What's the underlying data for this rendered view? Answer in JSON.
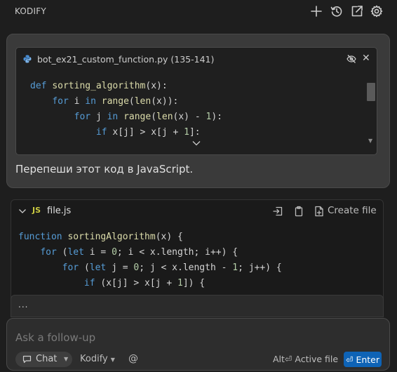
{
  "header": {
    "title": "KODIFY",
    "icons": [
      "plus-icon",
      "history-icon",
      "open-external-icon",
      "gear-icon"
    ]
  },
  "user_message": {
    "attachment": {
      "file_name": "bot_ex21_custom_function.py (135-141)",
      "code_lines": [
        [
          {
            "t": "def ",
            "c": "kw"
          },
          {
            "t": "sorting_algorithm",
            "c": "fn"
          },
          {
            "t": "(x):",
            "c": ""
          }
        ],
        [
          {
            "t": "    ",
            "c": ""
          },
          {
            "t": "for ",
            "c": "kw"
          },
          {
            "t": "i ",
            "c": ""
          },
          {
            "t": "in ",
            "c": "kw"
          },
          {
            "t": "range",
            "c": "fn"
          },
          {
            "t": "(",
            "c": ""
          },
          {
            "t": "len",
            "c": "fn"
          },
          {
            "t": "(x)):",
            "c": ""
          }
        ],
        [
          {
            "t": "        ",
            "c": ""
          },
          {
            "t": "for ",
            "c": "kw"
          },
          {
            "t": "j ",
            "c": ""
          },
          {
            "t": "in ",
            "c": "kw"
          },
          {
            "t": "range",
            "c": "fn"
          },
          {
            "t": "(",
            "c": ""
          },
          {
            "t": "len",
            "c": "fn"
          },
          {
            "t": "(x) - ",
            "c": ""
          },
          {
            "t": "1",
            "c": "num"
          },
          {
            "t": "):",
            "c": ""
          }
        ],
        [
          {
            "t": "            ",
            "c": ""
          },
          {
            "t": "if ",
            "c": "kw"
          },
          {
            "t": "x[j] > x[j + ",
            "c": ""
          },
          {
            "t": "1",
            "c": "num"
          },
          {
            "t": "]:",
            "c": ""
          }
        ]
      ]
    },
    "text": "Перепеши этот код в JavaScript."
  },
  "response": {
    "lang_badge": "JS",
    "file_name": "file.js",
    "create_file_label": "Create file",
    "code_lines": [
      [
        {
          "t": "function ",
          "c": "kw"
        },
        {
          "t": "sortingAlgorithm",
          "c": "fn"
        },
        {
          "t": "(x) {",
          "c": ""
        }
      ],
      [
        {
          "t": "    ",
          "c": ""
        },
        {
          "t": "for ",
          "c": "kw"
        },
        {
          "t": "(",
          "c": ""
        },
        {
          "t": "let ",
          "c": "kw"
        },
        {
          "t": "i = ",
          "c": ""
        },
        {
          "t": "0",
          "c": "num"
        },
        {
          "t": "; i < x.length; i++) {",
          "c": ""
        }
      ],
      [
        {
          "t": "        ",
          "c": ""
        },
        {
          "t": "for ",
          "c": "kw"
        },
        {
          "t": "(",
          "c": ""
        },
        {
          "t": "let ",
          "c": "kw"
        },
        {
          "t": "j = ",
          "c": ""
        },
        {
          "t": "0",
          "c": "num"
        },
        {
          "t": "; j < x.length - ",
          "c": ""
        },
        {
          "t": "1",
          "c": "num"
        },
        {
          "t": "; j++) {",
          "c": ""
        }
      ],
      [
        {
          "t": "            ",
          "c": ""
        },
        {
          "t": "if ",
          "c": "kw"
        },
        {
          "t": "(x[j] > x[j + ",
          "c": ""
        },
        {
          "t": "1",
          "c": "num"
        },
        {
          "t": "]) {",
          "c": ""
        }
      ]
    ]
  },
  "more_indicator": "...",
  "composer": {
    "placeholder": "Ask a follow-up",
    "mode_label": "Chat",
    "model_label": "Kodify",
    "at_symbol": "@",
    "active_file_label": "Alt⏎ Active file",
    "enter_label": "⏎ Enter"
  },
  "colors": {
    "background": "#1e1e1e",
    "user_bubble": "#3a3a3a",
    "keyword": "#569cd6",
    "function": "#dcdcaa",
    "number": "#b5cea8",
    "js_badge": "#cbcb41",
    "enter_button": "#0e63b6"
  }
}
